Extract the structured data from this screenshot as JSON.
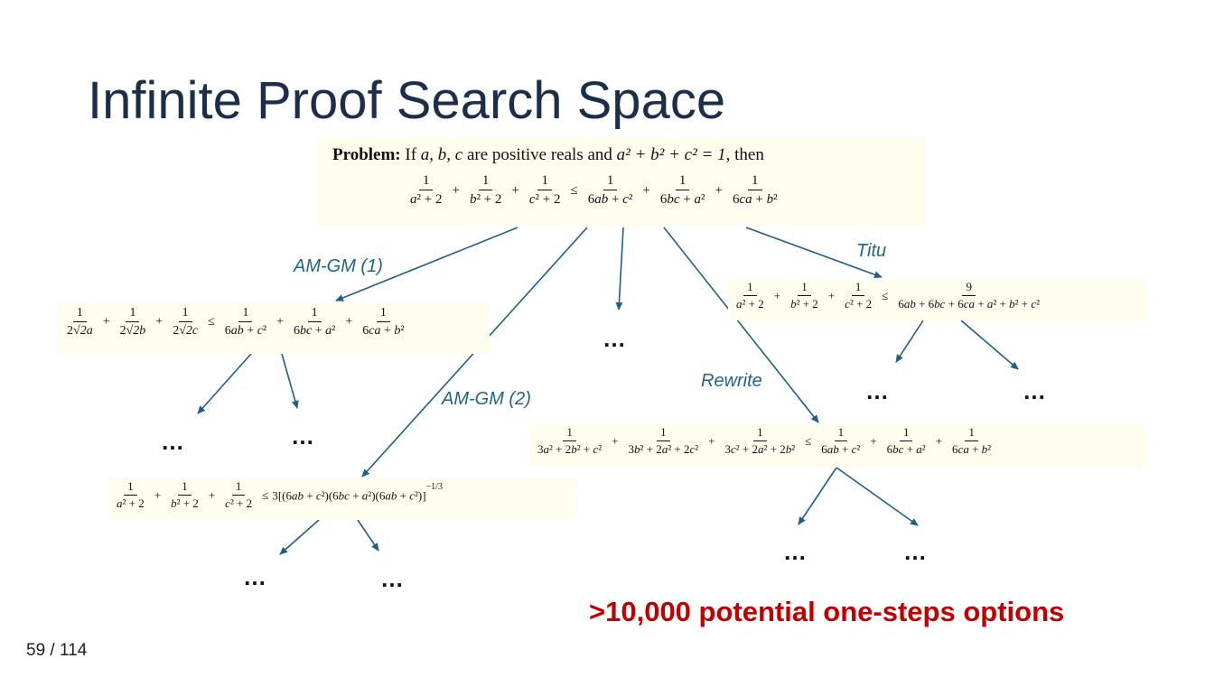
{
  "title": "Infinite Proof Search Space",
  "problem": {
    "label": "Problem:",
    "statement_prefix": "If",
    "vars": "a,  b,  c",
    "statement_mid": "are positive reals and",
    "condition": "a² + b² + c² = 1",
    "statement_suffix": ", then"
  },
  "edges": {
    "amgm1": "AM-GM (1)",
    "amgm2": "AM-GM (2)",
    "titu": "Titu",
    "rewrite": "Rewrite"
  },
  "dots": "…",
  "highlight": ">10,000 potential one-steps options",
  "page": {
    "current": "59",
    "sep": "/",
    "total": "114"
  },
  "colors": {
    "arrow": "#1f5f85",
    "box": "#fffdee",
    "title": "#1b2f4a",
    "highlight": "#c00000"
  }
}
